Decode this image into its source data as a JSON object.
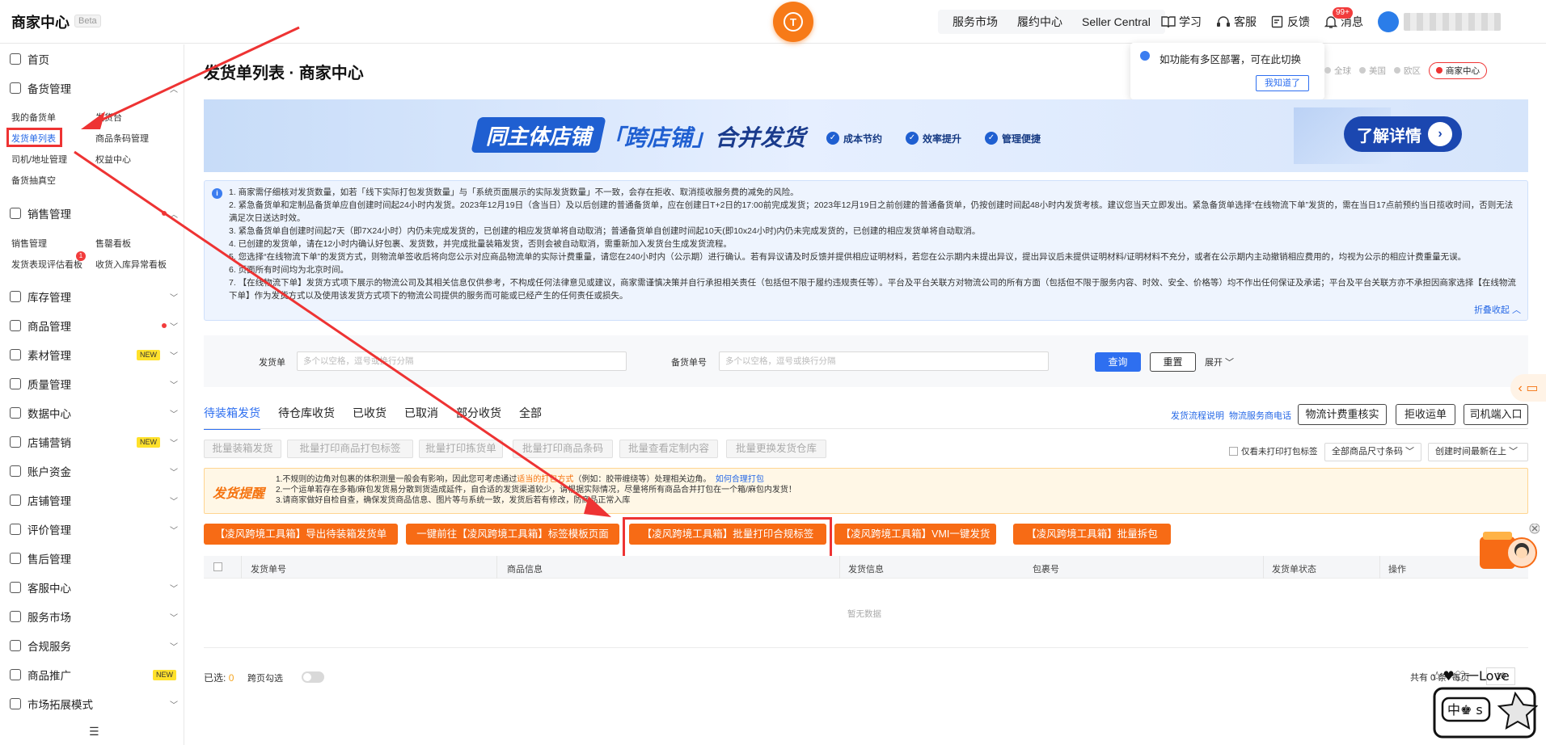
{
  "header": {
    "brand": "商家中心",
    "beta": "Beta",
    "nav": [
      "服务市场",
      "履约中心",
      "Seller Central"
    ],
    "icons": [
      {
        "label": "学习",
        "icon": "book-icon"
      },
      {
        "label": "客服",
        "icon": "headset-icon"
      },
      {
        "label": "反馈",
        "icon": "feedback-icon"
      },
      {
        "label": "消息",
        "icon": "bell-icon"
      }
    ],
    "message_badge": "99+"
  },
  "sidebar": {
    "items": [
      {
        "label": "首页",
        "icon": "home-icon"
      },
      {
        "label": "备货管理",
        "icon": "box-icon"
      },
      {
        "label": "销售管理",
        "icon": "chart-icon"
      },
      {
        "label": "库存管理",
        "icon": "warehouse-icon"
      },
      {
        "label": "商品管理",
        "icon": "goods-icon"
      },
      {
        "label": "素材管理",
        "icon": "material-icon"
      },
      {
        "label": "质量管理",
        "icon": "shield-icon"
      },
      {
        "label": "数据中心",
        "icon": "data-icon"
      },
      {
        "label": "店铺营销",
        "icon": "marketing-icon"
      },
      {
        "label": "账户资金",
        "icon": "wallet-icon"
      },
      {
        "label": "店铺管理",
        "icon": "store-icon"
      },
      {
        "label": "评价管理",
        "icon": "review-icon"
      },
      {
        "label": "售后管理",
        "icon": "aftersale-icon"
      },
      {
        "label": "客服中心",
        "icon": "service-icon"
      },
      {
        "label": "服务市场",
        "icon": "market-icon"
      },
      {
        "label": "合规服务",
        "icon": "compliance-icon"
      },
      {
        "label": "商品推广",
        "icon": "promo-icon"
      },
      {
        "label": "市场拓展模式",
        "icon": "expand-icon"
      }
    ],
    "new_label": "NEW",
    "stock_sub": [
      "我的备货单",
      "发货台",
      "发货单列表",
      "商品条码管理",
      "司机/地址管理",
      "权益中心",
      "备货抽真空"
    ],
    "sales_sub": [
      "销售管理",
      "售罄看板",
      "发货表现评估看板",
      "收货入库异常看板"
    ],
    "sales_badge": "1"
  },
  "page": {
    "title": "发货单列表 · 商家中心"
  },
  "region_popup": {
    "text": "如功能有多区部署，可在此切换",
    "button": "我知道了",
    "regions": [
      "全球",
      "美国",
      "欧区",
      "商家中心"
    ]
  },
  "banner": {
    "left": "同主体店铺",
    "middle_a": "「跨店铺」",
    "middle_b": "合并发货",
    "tags": [
      "成本节约",
      "效率提升",
      "管理便捷"
    ],
    "button": "了解详情"
  },
  "notice": {
    "lines": [
      "1. 商家需仔细核对发货数量，如若「线下实际打包发货数量」与「系统页面展示的实际发货数量」不一致，会存在拒收、取消揽收服务费的减免的风险。",
      "2. 紧急备货单和定制品备货单应自创建时间起24小时内发货。2023年12月19日（含当日）及以后创建的普通备货单，应在创建日T+2日的17:00前完成发货；2023年12月19日之前创建的普通备货单，仍按创建时间起48小时内发货考核。建议您当天立即发出。紧急备货单选择“在线物流下单”发货的，需在当日17点前预约当日揽收时间，否则无法满足次日送达时效。",
      "3. 紧急备货单自创建时间起7天（即7X24小时）内仍未完成发货的，已创建的相应发货单将自动取消；普通备货单自创建时间起10天(即10x24小时)内仍未完成发货的，已创建的相应发货单将自动取消。",
      "4. 已创建的发货单，请在12小时内确认好包裹、发货数，并完成批量装箱发货，否则会被自动取消，需重新加入发货台生成发货流程。",
      "5. 您选择“在线物流下单”的发货方式，则物流单签收后将向您公示对应商品物流单的实际计费重量，请您在240小时内（公示期）进行确认。若有异议请及时反馈并提供相应证明材料，若您在公示期内未提出异议，提出异议后未提供证明材料/证明材料不充分，或者在公示期内主动撤销相应费用的，均视为公示的相应计费重量无误。",
      "6. 页面所有时间均为北京时间。",
      "7. 【在线物流下单】发货方式项下展示的物流公司及其相关信息仅供参考，不构成任何法律意见或建议，商家需谨慎决策并自行承担相关责任（包括但不限于履约违规责任等）。平台及平台关联方对物流公司的所有方面（包括但不限于服务内容、时效、安全、价格等）均不作出任何保证及承诺；平台及平台关联方亦不承担因商家选择【在线物流下单】作为发货方式以及使用该发货方式项下的物流公司提供的服务而可能或已经产生的任何责任或损失。"
    ],
    "fold": "折叠收起"
  },
  "filter": {
    "label1": "发货单",
    "placeholder1": "多个以空格，逗号或换行分隔",
    "label2": "备货单号",
    "placeholder2": "多个以空格，逗号或换行分隔",
    "query": "查询",
    "reset": "重置",
    "expand": "展开"
  },
  "tabs": [
    "待装箱发货",
    "待仓库收货",
    "已收货",
    "已取消",
    "部分收货",
    "全部"
  ],
  "right_links": [
    "发货流程说明",
    "物流服务商电话"
  ],
  "right_buttons": [
    "物流计费重核实",
    "拒收运单",
    "司机端入口"
  ],
  "batch_buttons": [
    "批量装箱发货",
    "批量打印商品打包标签",
    "批量打印拣货单",
    "批量打印商品条码",
    "批量查看定制内容",
    "批量更换发货仓库"
  ],
  "only_unprinted": "仅看未打印打包标签",
  "selects": [
    "全部商品尺寸条码",
    "创建时间最新在上"
  ],
  "warn": {
    "title": "发货提醒",
    "line1_a": "1.不规则的边角对包裹的体积测量一般会有影响，因此您可考虑通过",
    "line1_b": "适当的打包方式",
    "line1_c": "（例如：胶带缠绕等）处理相关边角。",
    "line1_link": "如何合理打包",
    "line2": "2.一个运单若存在多箱/麻包发货易分散到货造成延件，自合适的发货渠道较少，请根据实际情况，尽量将所有商品合并打包在一个箱/麻包内发货！",
    "line3": "3.请商家做好自检自查，确保发货商品信息、图片等与系统一致，发货后若有修改，防商品正常入库"
  },
  "tool_buttons": [
    "【凌风跨境工具箱】导出待装箱发货单",
    "一键前往【凌风跨境工具箱】标签模板页面",
    "【凌风跨境工具箱】批量打印合规标签",
    "【凌风跨境工具箱】VMI一键发货",
    "【凌风跨境工具箱】批量拆包"
  ],
  "table": {
    "columns": [
      "发货单号",
      "商品信息",
      "发货信息",
      "包裹号",
      "发货单状态",
      "操作"
    ],
    "empty": "暂无数据"
  },
  "footer": {
    "selected_label": "已选:",
    "selected_count": "0",
    "cross_page": "跨页勾选",
    "total": "共有 0 条",
    "per_page": "每页",
    "page_size": "10"
  },
  "sticker": {
    "top": "☆♥♡一Love",
    "box": "中♚ s"
  },
  "colors": {
    "accent": "#2e6ff0",
    "orange": "#f76b15",
    "highlight": "#e33333"
  }
}
